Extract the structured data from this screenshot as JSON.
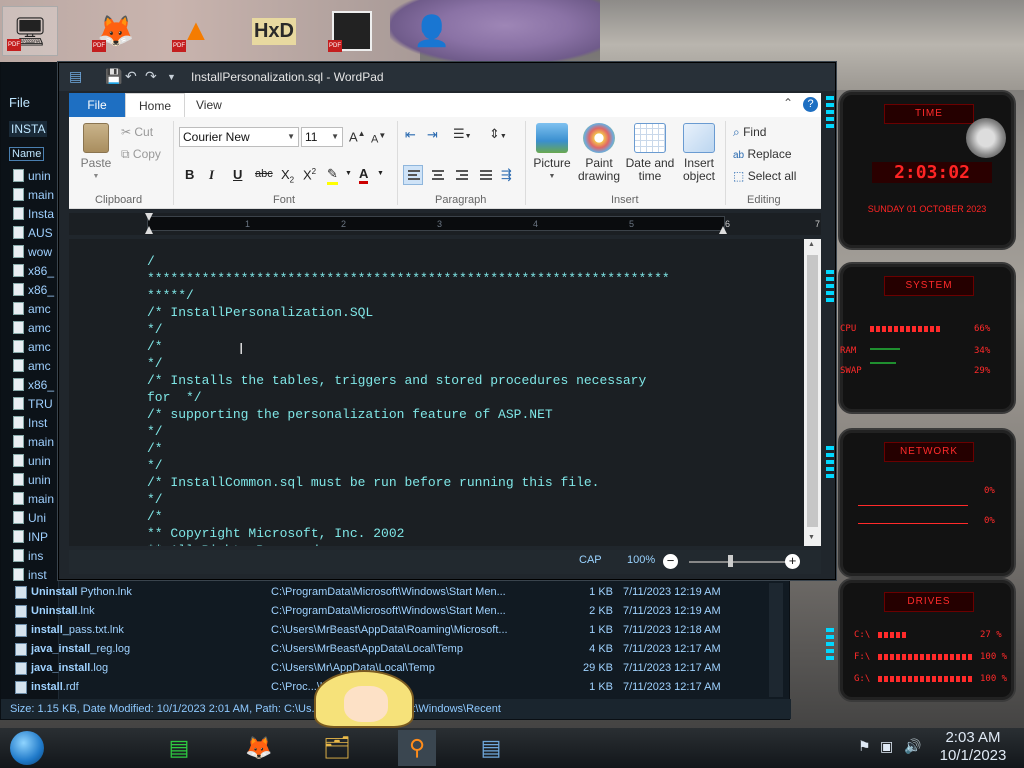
{
  "desktop": {
    "icons": [
      "computer",
      "firefox",
      "vlc",
      "hxd",
      "app",
      "user"
    ]
  },
  "explorer": {
    "menu_file": "File",
    "address_partial": "INSTA",
    "column_name": "Name",
    "left_items": [
      "unin",
      "main",
      "Insta",
      "AUS",
      "wow",
      "x86_",
      "x86_",
      "amc",
      "amc",
      "amc",
      "amc",
      "x86_",
      "TRU",
      "Inst",
      "main",
      "unin",
      "unin",
      "main",
      "Uni",
      "INP",
      "ins",
      "inst"
    ],
    "rows": [
      {
        "bold": "Uninstall",
        "rest": " Python.lnk",
        "path": "C:\\ProgramData\\Microsoft\\Windows\\Start Men...",
        "size": "1 KB",
        "date": "7/11/2023 12:19 AM"
      },
      {
        "bold": "Uninstall",
        "rest": ".lnk",
        "path": "C:\\ProgramData\\Microsoft\\Windows\\Start Men...",
        "size": "2 KB",
        "date": "7/11/2023 12:19 AM"
      },
      {
        "bold": "install",
        "rest": "_pass.txt.lnk",
        "path": "C:\\Users\\MrBeast\\AppData\\Roaming\\Microsoft...",
        "size": "1 KB",
        "date": "7/11/2023 12:18 AM"
      },
      {
        "bold": "java_install",
        "rest": "_reg.log",
        "path": "C:\\Users\\MrBeast\\AppData\\Local\\Temp",
        "size": "4 KB",
        "date": "7/11/2023 12:17 AM"
      },
      {
        "bold": "java_install",
        "rest": ".log",
        "path": "C:\\Users\\Mr\\AppData\\Local\\Temp",
        "size": "29 KB",
        "date": "7/11/2023 12:17 AM"
      },
      {
        "bold": "install",
        "rest": ".rdf",
        "path": "C:\\Proc...\\lib\\deploy\\jqs\\ff",
        "size": "1 KB",
        "date": "7/11/2023 12:17 AM"
      }
    ],
    "status": "Size: 1.15 KB, Date Modified: 10/1/2023 2:01 AM, Path: C:\\Us...\\Roaming\\Microsoft\\Windows\\Recent"
  },
  "wordpad": {
    "title": "InstallPersonalization.sql - WordPad",
    "tabs": {
      "file": "File",
      "home": "Home",
      "view": "View"
    },
    "clipboard": {
      "paste": "Paste",
      "cut": "Cut",
      "copy": "Copy",
      "label": "Clipboard"
    },
    "font": {
      "family": "Courier New",
      "size": "11",
      "label": "Font"
    },
    "paragraph": {
      "label": "Paragraph"
    },
    "insert": {
      "picture": "Picture",
      "paint": "Paint",
      "paint2": "drawing",
      "datetime": "Date and",
      "datetime2": "time",
      "object": "Insert",
      "object2": "object",
      "label": "Insert"
    },
    "editing": {
      "find": "Find",
      "replace": "Replace",
      "selectall": "Select all",
      "label": "Editing"
    },
    "ruler_marks": [
      "1",
      "2",
      "3",
      "4",
      "5",
      "6",
      "7"
    ],
    "document": "/\n*******************************************************************\n*****/\n/* InstallPersonalization.SQL\n*/\n/*\n*/\n/* Installs the tables, triggers and stored procedures necessary\nfor  */\n/* supporting the personalization feature of ASP.NET\n*/\n/*\n*/\n/* InstallCommon.sql must be run before running this file.\n*/\n/*\n** Copyright Microsoft, Inc. 2002\n** All Rights Reserved.",
    "status": {
      "cap": "CAP",
      "zoom": "100%"
    }
  },
  "gadgets": {
    "time_title": "TIME",
    "time": "2:03:02",
    "date": "SUNDAY 01 OCTOBER 2023",
    "system_title": "SYSTEM",
    "cpu": "CPU",
    "cpu_val": "66%",
    "ram": "RAM",
    "ram_val": "34%",
    "swap": "SWAP",
    "swap_val": "29%",
    "network_title": "NETWORK",
    "net_in": "0%",
    "net_out": "0%",
    "drives_title": "DRIVES",
    "c": "C:\\",
    "c_val": "27 %",
    "f": "F:\\",
    "f_val": "100 %",
    "g": "G:\\",
    "g_val": "100 %"
  },
  "taskbar": {
    "time": "2:03 AM",
    "date": "10/1/2023"
  },
  "colors": {
    "accent": "#1e6fc2",
    "doc_text": "#7fe6e6",
    "gadget_red": "#ff2424",
    "cyan": "#00d8ff"
  }
}
